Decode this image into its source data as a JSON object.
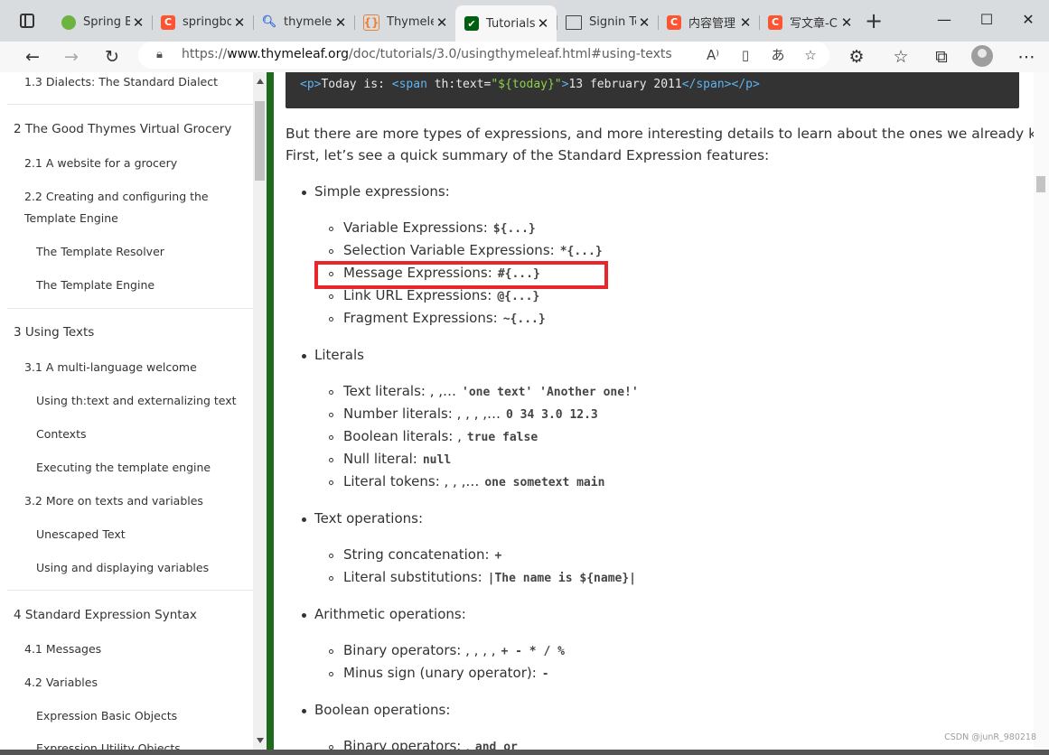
{
  "tabs": [
    {
      "title": "Spring B",
      "favicon": "spring-icon"
    },
    {
      "title": "springbo",
      "favicon": "csdn-icon"
    },
    {
      "title": "thymelea",
      "favicon": "search-icon"
    },
    {
      "title": "Thymele",
      "favicon": "code-icon"
    },
    {
      "title": "Tutorials",
      "favicon": "thymeleaf-icon",
      "active": true
    },
    {
      "title": "Signin Te",
      "favicon": "page-icon"
    },
    {
      "title": "内容管理",
      "favicon": "csdn-icon"
    },
    {
      "title": "写文章-C",
      "favicon": "csdn-icon"
    }
  ],
  "address_bar": {
    "prefix": "https://",
    "host": "www.thymeleaf.org",
    "path": "/doc/tutorials/3.0/usingthymeleaf.html#using-texts"
  },
  "toc": [
    {
      "label": "1.3 Dialects: The Standard Dialect",
      "level": 2
    },
    {
      "label": "2 The Good Thymes Virtual Grocery",
      "level": 1
    },
    {
      "label": "2.1 A website for a grocery",
      "level": 2
    },
    {
      "label": "2.2 Creating and configuring the",
      "level": 2
    },
    {
      "label": "Template Engine",
      "level": 2
    },
    {
      "label": "The Template Resolver",
      "level": 3
    },
    {
      "label": "The Template Engine",
      "level": 3
    },
    {
      "label": "3 Using Texts",
      "level": 1
    },
    {
      "label": "3.1 A multi-language welcome",
      "level": 2
    },
    {
      "label": "Using th:text and externalizing text",
      "level": 3
    },
    {
      "label": "Contexts",
      "level": 3
    },
    {
      "label": "Executing the template engine",
      "level": 3
    },
    {
      "label": "3.2 More on texts and variables",
      "level": 2
    },
    {
      "label": "Unescaped Text",
      "level": 3
    },
    {
      "label": "Using and displaying variables",
      "level": 3
    },
    {
      "label": "4 Standard Expression Syntax",
      "level": 1
    },
    {
      "label": "4.1 Messages",
      "level": 2
    },
    {
      "label": "4.2 Variables",
      "level": 2
    },
    {
      "label": "Expression Basic Objects",
      "level": 3
    },
    {
      "label": "Expression Utility Objects",
      "level": 3
    }
  ],
  "code": {
    "open_p": "<p>",
    "text1": "Today is: ",
    "open_span": "<span ",
    "attr": "th:text=",
    "str": "\"${today}\"",
    "gt": ">",
    "text2": "13 february 2011",
    "close_span": "</span>",
    "close_p": "</p>"
  },
  "intro": [
    "But there are more types of expressions, and more interesting details to learn about the ones we already know.",
    "First, let’s see a quick summary of the Standard Expression features:"
  ],
  "features": [
    {
      "label": "Simple expressions:",
      "items": [
        {
          "text": "Variable Expressions:",
          "code": "${...}"
        },
        {
          "text": "Selection Variable Expressions:",
          "code": "*{...}"
        },
        {
          "text": "Message Expressions:",
          "code": "#{...}"
        },
        {
          "text": "Link URL Expressions:",
          "code": "@{...}"
        },
        {
          "text": "Fragment Expressions:",
          "code": "~{...}"
        }
      ]
    },
    {
      "label": "Literals",
      "items": [
        {
          "text": "Text literals: , ,…",
          "code": "'one text' 'Another one!'"
        },
        {
          "text": "Number literals: , , , ,…",
          "code": "0 34 3.0 12.3"
        },
        {
          "text": "Boolean literals: ,",
          "code": "true false"
        },
        {
          "text": "Null literal:",
          "code": "null"
        },
        {
          "text": "Literal tokens: , , ,…",
          "code": "one sometext main"
        }
      ]
    },
    {
      "label": "Text operations:",
      "items": [
        {
          "text": "String concatenation:",
          "code": "+"
        },
        {
          "text": "Literal substitutions:",
          "code": "|The name is ${name}|"
        }
      ]
    },
    {
      "label": "Arithmetic operations:",
      "items": [
        {
          "text": "Binary operators: , , , ,",
          "code": "+ - * / %"
        },
        {
          "text": "Minus sign (unary operator):",
          "code": "-"
        }
      ]
    },
    {
      "label": "Boolean operations:",
      "items": [
        {
          "text": "Binary operators: ,",
          "code": "and or"
        }
      ]
    }
  ],
  "watermark": "CSDN @junR_980218",
  "colors": {
    "accent_green": "#1e6b1e",
    "highlight_red": "#e8262c",
    "csdn_orange": "#fc5531"
  }
}
